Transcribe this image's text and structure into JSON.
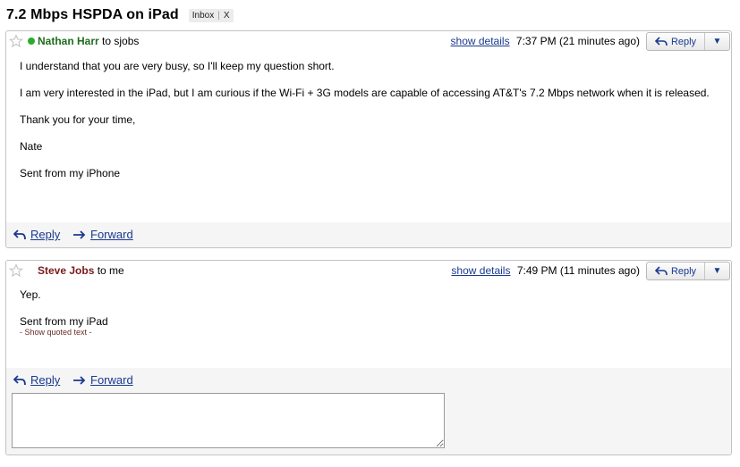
{
  "thread": {
    "subject": "7.2 Mbps HSPDA on iPad",
    "label": "Inbox",
    "label_remove": "X"
  },
  "messages": [
    {
      "sender": "Nathan Harr",
      "recipient_text": "to sjobs",
      "show_details": "show details",
      "time": "7:37 PM (21 minutes ago)",
      "reply_label": "Reply",
      "dropdown": "▼",
      "body": [
        "I understand that you are very busy, so I'll keep my question short.",
        "I am very interested in the iPad, but I am curious if the Wi-Fi + 3G models are capable of accessing AT&T's 7.2 Mbps network when it is released.",
        "Thank you for your time,",
        "Nate",
        "Sent from my iPhone"
      ],
      "footer_reply": "Reply",
      "footer_forward": "Forward"
    },
    {
      "sender": "Steve Jobs",
      "recipient_text": "to me",
      "show_details": "show details",
      "time": "7:49 PM (11 minutes ago)",
      "reply_label": "Reply",
      "dropdown": "▼",
      "body": [
        "Yep.",
        "Sent from my iPad"
      ],
      "quoted": "- Show quoted text -",
      "footer_reply": "Reply",
      "footer_forward": "Forward",
      "reply_box_value": ""
    }
  ],
  "colors": {
    "link": "#1a3a8f",
    "sender1": "#1f6e1f",
    "sender2": "#7a1b1b",
    "online": "#2dab2d",
    "footer_bg": "#f5f5f5"
  }
}
